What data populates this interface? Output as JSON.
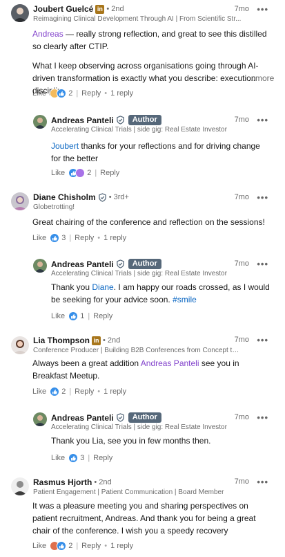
{
  "comments": [
    {
      "name": "Joubert Guelcé",
      "badge": "in",
      "degree": "• 2nd",
      "headline": "Reimagining Clinical Development Through AI | From Scientific Str...",
      "time": "7mo",
      "mention": "Andreas",
      "text1": " — really strong reflection, and great to see this distilled so clearly after CTIP.",
      "text2": "What I keep observing across organisations going through AI-driven transformation is exactly what you describe: execution disciplir",
      "see_more": "...more",
      "like": "Like",
      "reaction_count": "2",
      "reply": "Reply",
      "reply_count": "1 reply"
    },
    {
      "name": "Andreas Panteli",
      "author": "Author",
      "headline": "Accelerating Clinical Trials | side gig: Real Estate Investor",
      "time": "7mo",
      "mention": "Joubert",
      "text": " thanks for your reflections and for driving change for the better",
      "like": "Like",
      "reaction_count": "2",
      "reply": "Reply"
    },
    {
      "name": "Diane Chisholm",
      "degree": "• 3rd+",
      "headline": "Globetrotting!",
      "time": "7mo",
      "text": "Great chairing of the conference and reflection on the sessions!",
      "like": "Like",
      "reaction_count": "3",
      "reply": "Reply",
      "reply_count": "1 reply"
    },
    {
      "name": "Andreas Panteli",
      "author": "Author",
      "headline": "Accelerating Clinical Trials | side gig: Real Estate Investor",
      "time": "7mo",
      "text_a": "Thank you ",
      "mention": "Diane",
      "text_b": ". I am happy our roads crossed, as I would be seeking for your advice soon. ",
      "hashtag": "#smile",
      "like": "Like",
      "reaction_count": "1",
      "reply": "Reply"
    },
    {
      "name": "Lia Thompson",
      "badge": "in",
      "degree": "• 2nd",
      "headline": "Conference Producer | Building B2B Conferences from Concept to ...",
      "time": "7mo",
      "text_a": "Always been a great addition ",
      "mention": "Andreas Panteli",
      "text_b": " see you in Breakfast Meetup.",
      "like": "Like",
      "reaction_count": "2",
      "reply": "Reply",
      "reply_count": "1 reply"
    },
    {
      "name": "Andreas Panteli",
      "author": "Author",
      "headline": "Accelerating Clinical Trials | side gig: Real Estate Investor",
      "time": "7mo",
      "text": "Thank you Lia, see you in few months then.",
      "like": "Like",
      "reaction_count": "3",
      "reply": "Reply"
    },
    {
      "name": "Rasmus Hjorth",
      "degree": "• 2nd",
      "headline": "Patient Engagement | Patient Communication | Board Member",
      "time": "7mo",
      "text": "It was a pleasure meeting you and sharing perspectives on patient recruitment, Andreas. And thank you for being a great chair of the conference. I wish you a speedy recovery",
      "like": "Like",
      "reaction_count": "2",
      "reply": "Reply",
      "reply_count": "1 reply"
    }
  ],
  "more_menu_label": "•••",
  "colors": {
    "mention_purple": "#8344cc",
    "mention_blue": "#0a66c2",
    "author_badge": "#56687a",
    "like_blue": "#378fe9"
  }
}
